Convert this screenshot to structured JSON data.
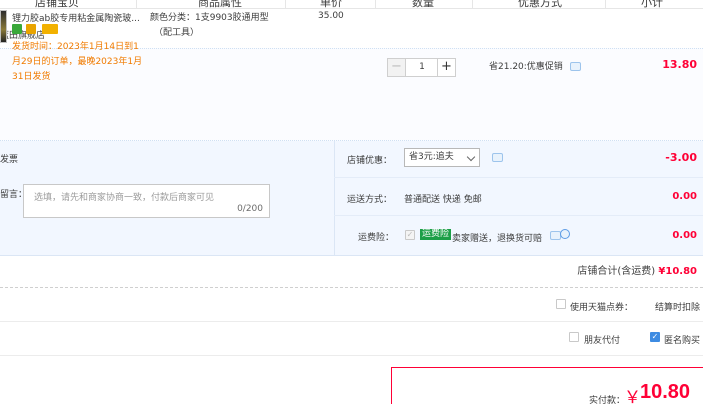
{
  "header": {
    "col_shop": "店铺宝贝",
    "col_attr": "商品属性",
    "col_price": "单价",
    "col_qty": "数量",
    "col_promo": "优惠方式",
    "col_subtotal": "小计"
  },
  "shop": {
    "name": "蓝田旗舰店"
  },
  "item": {
    "title": "锂力胶ab胶专用粘金属陶瓷玻...",
    "badges": [
      "7-day-return-icon",
      "guarantee-icon",
      "credit-card-icon"
    ],
    "ship_line1": "发货时间：2023年1月14日到1",
    "ship_line2": "月29日的订单，最晚2023年1月",
    "ship_line3": "31日发货",
    "attr_line1": "颜色分类：1支9903胶通用型",
    "attr_line2": "（配工具）",
    "price": "35.00",
    "qty": "1",
    "promo": "省21.20:优惠促销",
    "subtotal": "13.80"
  },
  "options": {
    "invoice_label": "发票",
    "message_label": "留言：",
    "message_placeholder": "选填，请先和商家协商一致，付款后商家可见",
    "message_count": "0/200",
    "shop_discount_label": "店铺优惠：",
    "shop_discount_value": "省3元:追夫",
    "shop_discount_amount": "-3.00",
    "delivery_label": "运送方式：",
    "delivery_value": "普通配送 快递 免邮",
    "delivery_amount": "0.00",
    "insurance_label": "运费险：",
    "insurance_tag": "运费险",
    "insurance_text": "卖家赠送，退换货可赔",
    "insurance_amount": "0.00"
  },
  "shop_total": {
    "label": "店铺合计(含运费)",
    "amount": "¥10.80"
  },
  "points": {
    "label": "使用天猫点券：",
    "note": "结算时扣除"
  },
  "pay_options": {
    "friend_pay": "朋友代付",
    "anonymous": "匿名购买"
  },
  "payment": {
    "label": "实付款：",
    "currency": "￥",
    "amount": "10.80"
  },
  "colors": {
    "accent_red": "#ff0036",
    "ship_orange": "#f07b00",
    "panel_blue": "#f2f7ff",
    "check_blue": "#3d8be2"
  }
}
